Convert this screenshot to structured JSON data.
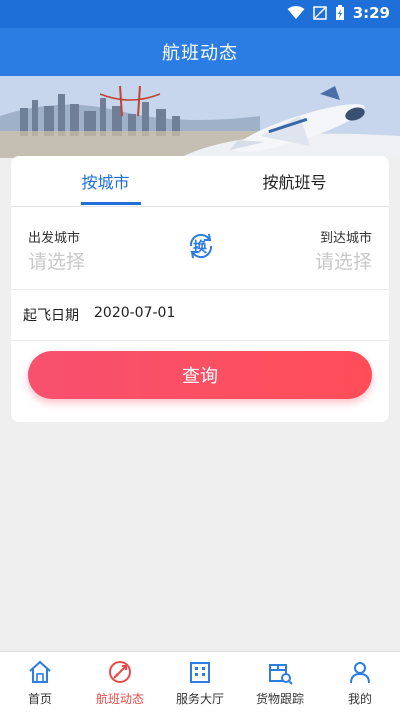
{
  "status_bar": {
    "time": "3:29"
  },
  "app_bar": {
    "title": "航班动态"
  },
  "tabs": [
    {
      "label": "按城市",
      "active": true
    },
    {
      "label": "按航班号",
      "active": false
    }
  ],
  "form": {
    "departure_label": "出发城市",
    "departure_placeholder": "请选择",
    "arrival_label": "到达城市",
    "arrival_placeholder": "请选择",
    "swap_label": "换",
    "date_label": "起飞日期",
    "date_value": "2020-07-01",
    "query_button": "查询"
  },
  "bottom_nav": [
    {
      "label": "首页",
      "icon": "home-icon",
      "active": false
    },
    {
      "label": "航班动态",
      "icon": "flight-status-icon",
      "active": true
    },
    {
      "label": "服务大厅",
      "icon": "building-icon",
      "active": false
    },
    {
      "label": "货物跟踪",
      "icon": "cargo-tracking-icon",
      "active": false
    },
    {
      "label": "我的",
      "icon": "user-icon",
      "active": false
    }
  ],
  "colors": {
    "primary": "#2b7de3",
    "accent_red": "#ff4d58",
    "active_nav": "#e84a4a",
    "nav_icon_blue": "#2b7de3"
  }
}
